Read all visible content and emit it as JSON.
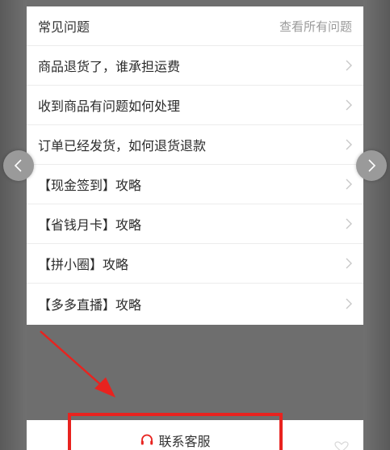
{
  "faq": {
    "title": "常见问题",
    "view_all": "查看所有问题",
    "items": [
      {
        "label": "商品退货了，谁承担运费"
      },
      {
        "label": "收到商品有问题如何处理"
      },
      {
        "label": "订单已经发货，如何退货退款"
      },
      {
        "label": "【现金签到】攻略"
      },
      {
        "label": "【省钱月卡】攻略"
      },
      {
        "label": "【拼小圈】攻略"
      },
      {
        "label": "【多多直播】攻略"
      }
    ]
  },
  "contact": {
    "label": "联系客服",
    "icon": "headset-icon",
    "accent_color": "#e8231f"
  },
  "icons": {
    "prev": "chevron-left-icon",
    "next": "chevron-right-icon",
    "item_chevron": "chevron-right-icon",
    "favorite": "heart-icon"
  }
}
